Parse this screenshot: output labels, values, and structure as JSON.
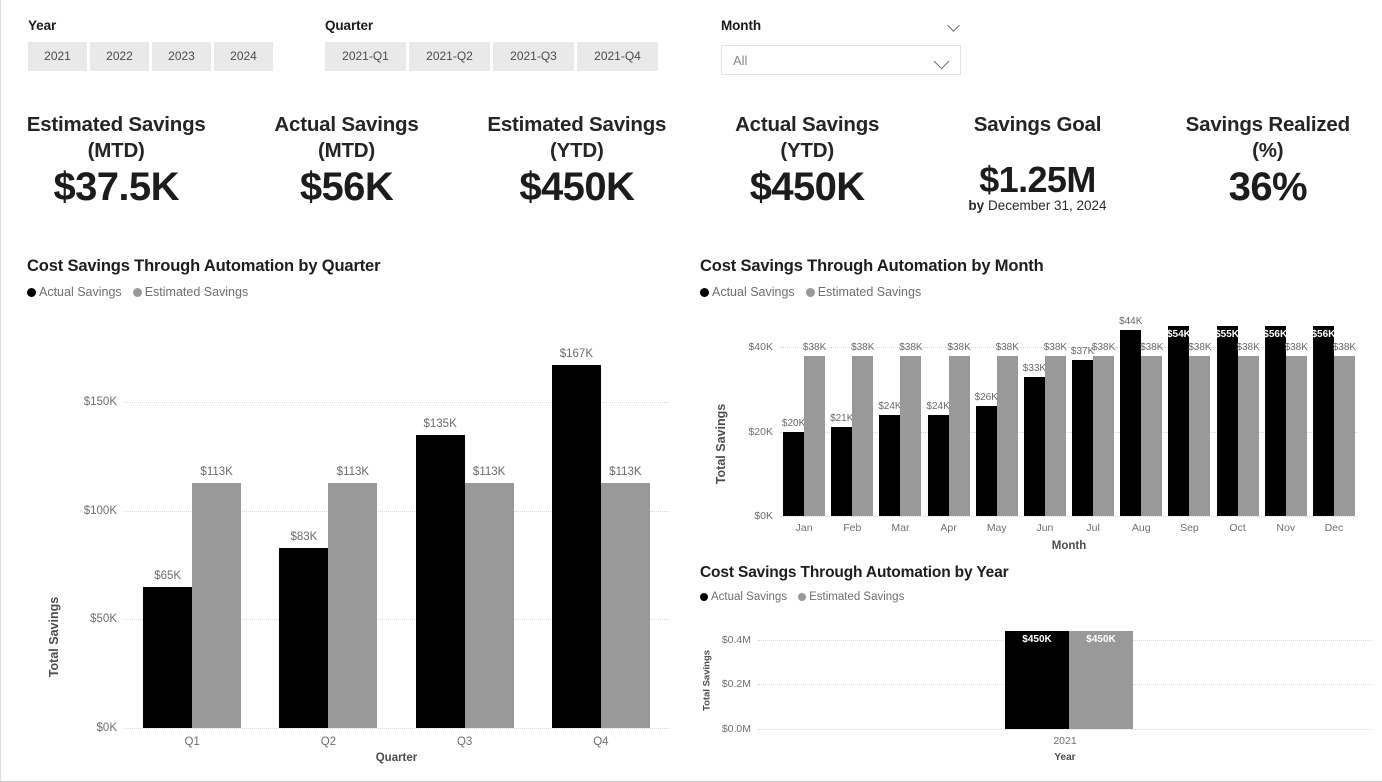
{
  "slicers": {
    "year": {
      "label": "Year",
      "options": [
        "2021",
        "2022",
        "2023",
        "2024"
      ]
    },
    "quarter": {
      "label": "Quarter",
      "options": [
        "2021-Q1",
        "2021-Q2",
        "2021-Q3",
        "2021-Q4"
      ]
    },
    "month": {
      "label": "Month",
      "value": "All",
      "chevron_icon": "chevron-down-icon"
    }
  },
  "kpis": [
    {
      "title": "Estimated Savings",
      "subtitle": "(MTD)",
      "value": "$37.5K"
    },
    {
      "title": "Actual Savings",
      "subtitle": "(MTD)",
      "value": "$56K"
    },
    {
      "title": "Estimated Savings",
      "subtitle": "(YTD)",
      "value": "$450K"
    },
    {
      "title": "Actual Savings",
      "subtitle": "(YTD)",
      "value": "$450K"
    },
    {
      "title": "Savings Goal",
      "subtitle": "",
      "value": "$1.25M",
      "note_prefix": "by",
      "note": "December 31, 2024"
    },
    {
      "title": "Savings Realized",
      "subtitle": "(%)",
      "value": "36%"
    }
  ],
  "legend": {
    "actual": "Actual Savings",
    "estimated": "Estimated Savings",
    "actual_color": "#000000",
    "estimated_color": "#999999"
  },
  "chart_data": [
    {
      "id": "quarter",
      "type": "bar",
      "title": "Cost Savings Through Automation by Quarter",
      "xlabel": "Quarter",
      "ylabel": "Total Savings",
      "categories": [
        "Q1",
        "Q2",
        "Q3",
        "Q4"
      ],
      "yticks": [
        "$0K",
        "$50K",
        "$100K",
        "$150K"
      ],
      "ytick_values": [
        0,
        50000,
        100000,
        150000
      ],
      "ylim": [
        0,
        180000
      ],
      "grid": true,
      "legend_position": "top-left",
      "series": [
        {
          "name": "Actual Savings",
          "color": "#000000",
          "values": [
            65000,
            83000,
            135000,
            167000
          ],
          "labels": [
            "$65K",
            "$83K",
            "$135K",
            "$167K"
          ]
        },
        {
          "name": "Estimated Savings",
          "color": "#999999",
          "values": [
            113000,
            113000,
            113000,
            113000
          ],
          "labels": [
            "$113K",
            "$113K",
            "$113K",
            "$113K"
          ]
        }
      ]
    },
    {
      "id": "month",
      "type": "bar",
      "title": "Cost Savings Through Automation by Month",
      "xlabel": "Month",
      "ylabel": "Total Savings",
      "categories": [
        "Jan",
        "Feb",
        "Mar",
        "Apr",
        "May",
        "Jun",
        "Jul",
        "Aug",
        "Sep",
        "Oct",
        "Nov",
        "Dec"
      ],
      "yticks": [
        "$0K",
        "$20K",
        "$40K"
      ],
      "ytick_values": [
        0,
        20000,
        40000
      ],
      "ylim": [
        0,
        45000
      ],
      "grid": true,
      "legend_position": "top-left",
      "series": [
        {
          "name": "Actual Savings",
          "color": "#000000",
          "values": [
            20000,
            21000,
            24000,
            24000,
            26000,
            33000,
            37000,
            44000,
            54000,
            55000,
            56000,
            56000
          ],
          "labels": [
            "$20K",
            "$21K",
            "$24K",
            "$24K",
            "$26K",
            "$33K",
            "$37K",
            "$44K",
            "$54K",
            "$55K",
            "$56K",
            "$56K"
          ]
        },
        {
          "name": "Estimated Savings",
          "color": "#999999",
          "values": [
            38000,
            38000,
            38000,
            38000,
            38000,
            38000,
            38000,
            38000,
            38000,
            38000,
            38000,
            38000
          ],
          "labels": [
            "$38K",
            "$38K",
            "$38K",
            "$38K",
            "$38K",
            "$38K",
            "$38K",
            "$38K",
            "$38K",
            "$38K",
            "$38K",
            "$38K"
          ]
        }
      ]
    },
    {
      "id": "year",
      "type": "bar",
      "title": "Cost Savings Through Automation by Year",
      "xlabel": "Year",
      "ylabel": "Total Savings",
      "categories": [
        "2021"
      ],
      "yticks": [
        "$0.0M",
        "$0.2M",
        "$0.4M"
      ],
      "ytick_values": [
        0,
        200000,
        400000
      ],
      "ylim": [
        0,
        440000
      ],
      "grid": true,
      "legend_position": "top-left",
      "series": [
        {
          "name": "Actual Savings",
          "color": "#000000",
          "values": [
            450000
          ],
          "labels": [
            "$450K"
          ]
        },
        {
          "name": "Estimated Savings",
          "color": "#999999",
          "values": [
            450000
          ],
          "labels": [
            "$450K"
          ]
        }
      ]
    }
  ]
}
